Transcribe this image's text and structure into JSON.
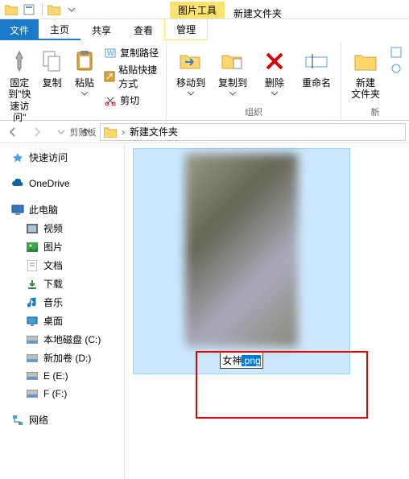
{
  "qat": {
    "title": "新建文件夹"
  },
  "contextual": {
    "group": "图片工具",
    "tab": "管理"
  },
  "tabs": {
    "file": "文件",
    "home": "主页",
    "share": "共享",
    "view": "查看"
  },
  "title": "新建文件夹",
  "ribbon": {
    "pin": {
      "label": "固定到\"快\n速访问\""
    },
    "copy": {
      "label": "复制"
    },
    "paste": {
      "label": "粘贴"
    },
    "copypath": "复制路径",
    "pasteshortcut": "粘贴快捷方式",
    "cut": "剪切",
    "group_clipboard": "剪贴板",
    "moveto": "移动到",
    "copyto": "复制到",
    "delete": "删除",
    "rename": "重命名",
    "group_organize": "组织",
    "newfolder": "新建\n文件夹",
    "group_new": "新"
  },
  "address": {
    "folder": "新建文件夹"
  },
  "tree": {
    "quickaccess": "快速访问",
    "onedrive": "OneDrive",
    "thispc": "此电脑",
    "videos": "视频",
    "pictures": "图片",
    "documents": "文档",
    "downloads": "下载",
    "music": "音乐",
    "desktop": "桌面",
    "diskC": "本地磁盘 (C:)",
    "diskD": "新加卷 (D:)",
    "diskE": "E (E:)",
    "diskF": "F (F:)",
    "network": "网络"
  },
  "file": {
    "name_base": "女神",
    "name_ext": ".png"
  }
}
